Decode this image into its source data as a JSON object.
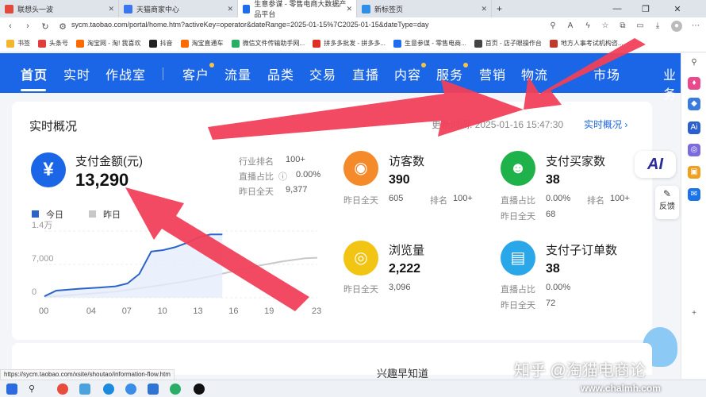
{
  "browser": {
    "tabs": [
      {
        "title": "联想头一波",
        "color": "#e24b3b",
        "active": false
      },
      {
        "title": "天猫商家中心",
        "color": "#3a76f0",
        "active": false
      },
      {
        "title": "生意参谋 - 零售电商大数据产品平台",
        "color": "#1e6cf0",
        "active": true
      },
      {
        "title": "新标签页",
        "color": "#2f8ee8",
        "active": false
      }
    ],
    "new_tab": "+",
    "url": "sycm.taobao.com/portal/home.htm?activeKey=operator&dateRange=2025-01-15%7C2025-01-15&dateType=day",
    "bookmarks": [
      {
        "label": "书签",
        "color": "#f3b72e"
      },
      {
        "label": "头条号",
        "color": "#e23d3d"
      },
      {
        "label": "淘宝网 - 淘! 我喜欢",
        "color": "#ff6a00"
      },
      {
        "label": "抖音",
        "color": "#222222"
      },
      {
        "label": "淘宝直通车",
        "color": "#ff6a00"
      },
      {
        "label": "微信文件传输助手网...",
        "color": "#2aae67"
      },
      {
        "label": "拼多多批发 - 拼多多...",
        "color": "#e02e24"
      },
      {
        "label": "生意参谋 - 零售电商...",
        "color": "#1e6cf0"
      },
      {
        "label": "首页 - 店子眼操作台",
        "color": "#444444"
      },
      {
        "label": "地方人事考试机构咨...",
        "color": "#c0392b"
      }
    ],
    "status_url": "https://sycm.taobao.com/xsite/shoutao/information-flow.htm"
  },
  "nav": {
    "items": [
      {
        "label": "首页",
        "active": true,
        "dot": false
      },
      {
        "label": "实时",
        "active": false,
        "dot": false
      },
      {
        "label": "作战室",
        "active": false,
        "dot": false
      },
      {
        "label": "客户",
        "active": false,
        "dot": true
      },
      {
        "label": "流量",
        "active": false,
        "dot": false
      },
      {
        "label": "品类",
        "active": false,
        "dot": false
      },
      {
        "label": "交易",
        "active": false,
        "dot": false
      },
      {
        "label": "直播",
        "active": false,
        "dot": false
      },
      {
        "label": "内容",
        "active": false,
        "dot": true
      },
      {
        "label": "服务",
        "active": false,
        "dot": true
      },
      {
        "label": "营销",
        "active": false,
        "dot": false
      },
      {
        "label": "物流",
        "active": false,
        "dot": false
      },
      {
        "label": "市场",
        "active": false,
        "dot": false
      },
      {
        "label": "业务",
        "active": false,
        "dot": false
      }
    ],
    "accent": "#1b66e6"
  },
  "realtime": {
    "title": "实时概况",
    "update_label": "更新时间:",
    "update_time": "2025-01-16 15:47:30",
    "link": "实时概况",
    "pay_amount": {
      "title": "支付金额(元)",
      "value": "13,290",
      "rank_label": "行业排名",
      "rank_value": "100+",
      "live_label": "直播占比",
      "live_value": "0.00%",
      "yesterday_label": "昨日全天",
      "yesterday_value": "9,377"
    },
    "visitors": {
      "title": "访客数",
      "value": "390",
      "yesterday_label": "昨日全天",
      "yesterday_value": "605",
      "rank_label": "排名",
      "rank_value": "100+"
    },
    "buyers": {
      "title": "支付买家数",
      "value": "38",
      "live_label": "直播占比",
      "live_value": "0.00%",
      "rank_label": "排名",
      "rank_value": "100+",
      "yesterday_label": "昨日全天",
      "yesterday_value": "68"
    },
    "pageviews": {
      "title": "浏览量",
      "value": "2,222",
      "yesterday_label": "昨日全天",
      "yesterday_value": "3,096"
    },
    "sub_orders": {
      "title": "支付子订单数",
      "value": "38",
      "live_label": "直播占比",
      "live_value": "0.00%",
      "yesterday_label": "昨日全天",
      "yesterday_value": "72"
    },
    "colors": {
      "pay": "#1b66e6",
      "visitors": "#f58a2b",
      "buyers": "#1fb24a",
      "pageviews": "#f2c514",
      "orders": "#2aa7e8"
    }
  },
  "chart_data": {
    "type": "line",
    "legend": [
      "今日",
      "昨日"
    ],
    "y_tick_labels": [
      "1.4万",
      "7,000",
      "0"
    ],
    "ylim": [
      0,
      14000
    ],
    "x_tick_labels": [
      "00",
      "04",
      "07",
      "10",
      "13",
      "16",
      "19",
      "23"
    ],
    "series": [
      {
        "name": "今日",
        "color": "#2a64c8",
        "x": [
          0,
          1,
          3,
          5,
          6,
          7,
          8,
          9,
          10,
          11,
          12,
          13,
          14,
          15
        ],
        "values": [
          300,
          1500,
          1900,
          2200,
          2400,
          3000,
          5000,
          9700,
          10000,
          10600,
          11500,
          12700,
          13290,
          13290
        ]
      },
      {
        "name": "昨日",
        "color": "#c8c8c8",
        "x": [
          0,
          2,
          4,
          6,
          8,
          10,
          12,
          14,
          16,
          18,
          20,
          22,
          23
        ],
        "values": [
          200,
          500,
          900,
          1300,
          2000,
          2700,
          3500,
          4500,
          5600,
          6700,
          7600,
          8300,
          8400
        ]
      }
    ]
  },
  "sidebar_right": {
    "feedback": "反馈",
    "ai": "AI"
  },
  "watermark": "知乎 @淘猫电商论",
  "site_watermark": "www.chalmh.com",
  "next_section": "兴趣早知道"
}
